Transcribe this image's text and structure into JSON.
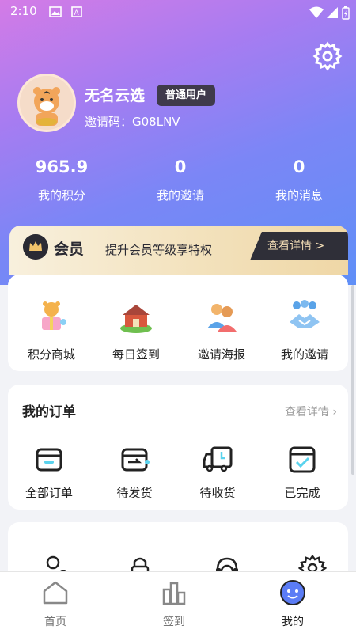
{
  "status_bar": {
    "time": "2:10"
  },
  "profile": {
    "username": "无名云选",
    "badge": "普通用户",
    "invite_code": "邀请码：G08LNV"
  },
  "stats": [
    {
      "value": "965.9",
      "label": "我的积分"
    },
    {
      "value": "0",
      "label": "我的邀请"
    },
    {
      "value": "0",
      "label": "我的消息"
    }
  ],
  "vip": {
    "title": "会员",
    "desc": "提升会员等级享特权",
    "more": "查看详情 >"
  },
  "quick_actions": [
    {
      "label": "积分商城",
      "icon": "gift-mascot-icon"
    },
    {
      "label": "每日签到",
      "icon": "farmhouse-icon"
    },
    {
      "label": "邀请海报",
      "icon": "people-icon"
    },
    {
      "label": "我的邀请",
      "icon": "handshake-icon"
    }
  ],
  "orders": {
    "title": "我的订单",
    "more": "查看详情",
    "items": [
      {
        "label": "全部订单",
        "icon": "box-icon"
      },
      {
        "label": "待发货",
        "icon": "ship-box-icon"
      },
      {
        "label": "待收货",
        "icon": "truck-icon"
      },
      {
        "label": "已完成",
        "icon": "check-calendar-icon"
      }
    ]
  },
  "tools": [
    {
      "icon": "user-settings-icon"
    },
    {
      "icon": "lock-icon"
    },
    {
      "icon": "customer-service-icon"
    },
    {
      "icon": "settings-icon"
    }
  ],
  "tabbar": [
    {
      "label": "首页",
      "icon": "home-icon"
    },
    {
      "label": "签到",
      "icon": "sign-in-icon"
    },
    {
      "label": "我的",
      "icon": "profile-face-icon",
      "active": true
    }
  ],
  "colors": {
    "accent_purple": "#9b7cf0",
    "accent_blue": "#5f8ff7",
    "vip_gold": "#efd7a6",
    "dark": "#2f2f38"
  }
}
